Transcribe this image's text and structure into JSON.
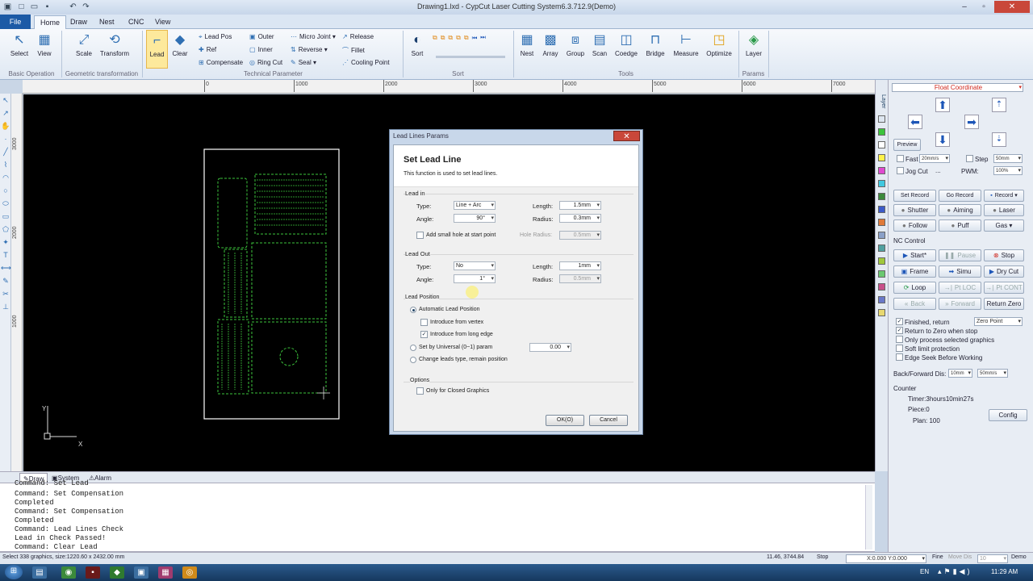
{
  "window": {
    "title": "Drawing1.lxd - CypCut Laser Cutting System6.3.712.9(Demo)"
  },
  "ribbon_tabs": {
    "file": "File",
    "home": "Home",
    "draw": "Draw",
    "nest": "Nest",
    "cnc": "CNC",
    "view": "View"
  },
  "ribbon": {
    "select": "Select",
    "view": "View",
    "scale": "Scale",
    "transform": "Transform",
    "lead": "Lead",
    "clear": "Clear",
    "lead_pos": "Lead Pos",
    "ref": "Ref",
    "compensate": "Compensate",
    "outer": "Outer",
    "inner": "Inner",
    "ring_cut": "Ring Cut",
    "micro_joint": "Micro Joint",
    "reverse": "Reverse",
    "seal": "Seal",
    "release": "Release",
    "fillet": "Fillet",
    "cooling_point": "Cooling Point",
    "sort": "Sort",
    "nest": "Nest",
    "array": "Array",
    "group": "Group",
    "scan": "Scan",
    "coedge": "Coedge",
    "bridge": "Bridge",
    "measure": "Measure",
    "optimize": "Optimize",
    "layer": "Layer",
    "groups": {
      "basic_operation": "Basic Operation",
      "geometric_transformation": "Geometric transformation",
      "technical_parameter": "Technical Parameter",
      "sort": "Sort",
      "tools": "Tools",
      "params": "Params"
    }
  },
  "ruler": {
    "h": [
      "0",
      "1000",
      "2000",
      "3000",
      "4000",
      "5000",
      "6000",
      "7000"
    ],
    "v": [
      "3000",
      "2000",
      "1000"
    ]
  },
  "canvas": {
    "axis_y": "Y",
    "axis_x": "X"
  },
  "dialog": {
    "title": "Lead Lines Params",
    "heading": "Set Lead Line",
    "description": "This function is used to set lead lines.",
    "lead_in": {
      "legend": "Lead in",
      "type_label": "Type:",
      "type_value": "Line + Arc",
      "angle_label": "Angle:",
      "angle_value": "90°",
      "length_label": "Length:",
      "length_value": "1.5mm",
      "radius_label": "Radius:",
      "radius_value": "0.3mm",
      "hole_label": "Add small hole at start point",
      "hole_radius_label": "Hole Radius:",
      "hole_radius_value": "0.5mm"
    },
    "lead_out": {
      "legend": "Lead Out",
      "type_label": "Type:",
      "type_value": "No",
      "angle_label": "Angle:",
      "angle_value": "1°",
      "length_label": "Length:",
      "length_value": "1mm",
      "radius_label": "Radius:",
      "radius_value": "0.5mm"
    },
    "lead_position": {
      "legend": "Lead Position",
      "auto": "Automatic Lead Position",
      "vertex": "Introduce from vertex",
      "long_edge": "Introduce from long edge",
      "universal": "Set by Universal (0~1) param",
      "universal_value": "0.00",
      "change": "Change leads type, remain position"
    },
    "options": {
      "legend": "Options",
      "closed_only": "Only for Closed Graphics"
    },
    "ok": "OK(O)",
    "cancel": "Cancel"
  },
  "right_panel": {
    "coordinate": "Float Coordinate",
    "preview": "Preview",
    "fast": "Fast",
    "fast_value": "20mm/s",
    "step": "Step",
    "step_value": "50mm",
    "jog_cut": "Jog Cut",
    "jog_value": "...",
    "pwm": "PWM:",
    "pwm_value": "100%",
    "set_record": "Set Record",
    "go_record": "Go Record",
    "record": "Record",
    "shutter": "Shutter",
    "aiming": "Aiming",
    "laser": "Laser",
    "follow": "Follow",
    "puff": "Puff",
    "gas": "Gas",
    "nc_control": "NC Control",
    "start": "Start*",
    "pause": "Pause",
    "stop": "Stop",
    "frame": "Frame",
    "simu": "Simu",
    "dry_cut": "Dry Cut",
    "loop": "Loop",
    "pt_loc": "Pt LOC",
    "pt_cont": "Pt CONT",
    "back": "Back",
    "forward": "Forward",
    "return_zero": "Return Zero",
    "finished_return": "Finished, return",
    "zero_point": "Zero Point",
    "return_zero_stop": "Return to Zero when stop",
    "only_selected": "Only process selected graphics",
    "soft_limit": "Soft limit protection",
    "edge_seek": "Edge Seek Before Working",
    "back_forward_dis": "Back/Forward Dis:",
    "bf_dis_value": "10mm",
    "bf_speed_value": "50mm/s",
    "counter": "Counter",
    "timer": "Timer:3hours10min27s",
    "piece": "Piece:0",
    "plan": "Plan: 100",
    "config": "Config"
  },
  "cmd_tabs": {
    "draw": "Draw",
    "system": "System",
    "alarm": "Alarm"
  },
  "command_lines": [
    "Command: Set Lead",
    "Command: Set Compensation",
    "Completed",
    "Command: Set Compensation",
    "Completed",
    "Command: Lead Lines Check",
    "Lead in Check Passed!",
    "Command: Clear Lead"
  ],
  "status": {
    "selection": "Select 338 graphics, size:1220.60 x 2432.00 mm",
    "coords": "11.46, 3744.84",
    "state": "Stop",
    "xy": "X:0.000 Y:0.000",
    "fine": "Fine",
    "move_dis": "Move Dis",
    "move_value": "10",
    "demo": "Demo"
  },
  "taskbar": {
    "lang": "EN",
    "time": "11:29 AM"
  },
  "colors": {
    "accent": "#1c5aa6",
    "canvas": "#000000",
    "part": "#ffffff",
    "path": "#3cc43c",
    "coordinate": "#d0281e"
  }
}
